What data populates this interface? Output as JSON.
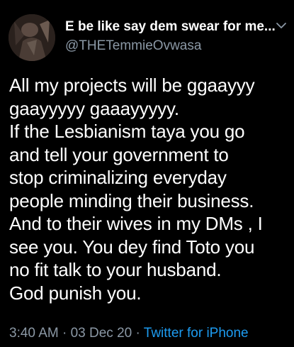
{
  "user": {
    "display_name": "E be like say dem swear for me...",
    "handle": "@THETemmieOvwasa"
  },
  "tweet": {
    "lines": [
      "All my projects will be ggaayyy",
      "gaayyyyy gaaayyyyy.",
      "If the Lesbianism taya you go",
      "and tell your government to",
      "stop criminalizing everyday",
      "people minding their business.",
      "And to their wives in my DMs , I",
      "see you. You dey find Toto you",
      "no fit talk to your husband.",
      "God punish you."
    ]
  },
  "meta": {
    "time": "3:40 AM",
    "separator": "·",
    "date": "03 Dec 20",
    "source": "Twitter for iPhone"
  },
  "icons": {
    "avatar": "profile-photo",
    "menu": "chevron-down-icon"
  },
  "colors": {
    "background": "#000000",
    "text": "#ffffff",
    "secondary": "#8b98a5",
    "accent": "#1d9bf0"
  }
}
